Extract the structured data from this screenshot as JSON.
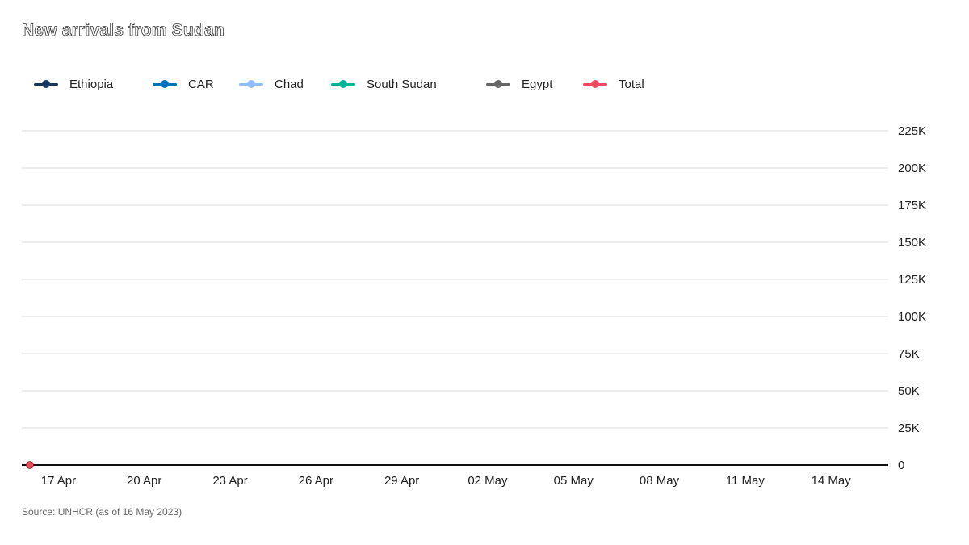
{
  "title": "New arrivals from Sudan",
  "source": "Source: UNHCR (as of 16 May 2023)",
  "legend": [
    {
      "label": "Ethiopia",
      "color": "#18375f"
    },
    {
      "label": "CAR",
      "color": "#0072bc"
    },
    {
      "label": "Chad",
      "color": "#8ebeff"
    },
    {
      "label": "South Sudan",
      "color": "#00b398"
    },
    {
      "label": "Egypt",
      "color": "#666666"
    },
    {
      "label": "Total",
      "color": "#ef4a60"
    }
  ],
  "chart_data": {
    "type": "line",
    "title": "New arrivals from Sudan",
    "xlabel": "",
    "ylabel": "",
    "y_tick_labels": [
      "0",
      "25K",
      "50K",
      "75K",
      "100K",
      "125K",
      "150K",
      "175K",
      "200K",
      "225K"
    ],
    "y_ticks": [
      0,
      25000,
      50000,
      75000,
      100000,
      125000,
      150000,
      175000,
      200000,
      225000
    ],
    "ylim": [
      0,
      225000
    ],
    "x_tick_labels": [
      "17 Apr",
      "20 Apr",
      "23 Apr",
      "26 Apr",
      "29 Apr",
      "02 May",
      "05 May",
      "08 May",
      "11 May",
      "14 May"
    ],
    "xlim": [
      "2023-04-16",
      "2023-05-16"
    ],
    "grid": true,
    "legend_position": "top-left",
    "series": [
      {
        "name": "Total",
        "color": "#ef4a60",
        "x": [
          "2023-04-16"
        ],
        "y": [
          0
        ]
      }
    ]
  }
}
